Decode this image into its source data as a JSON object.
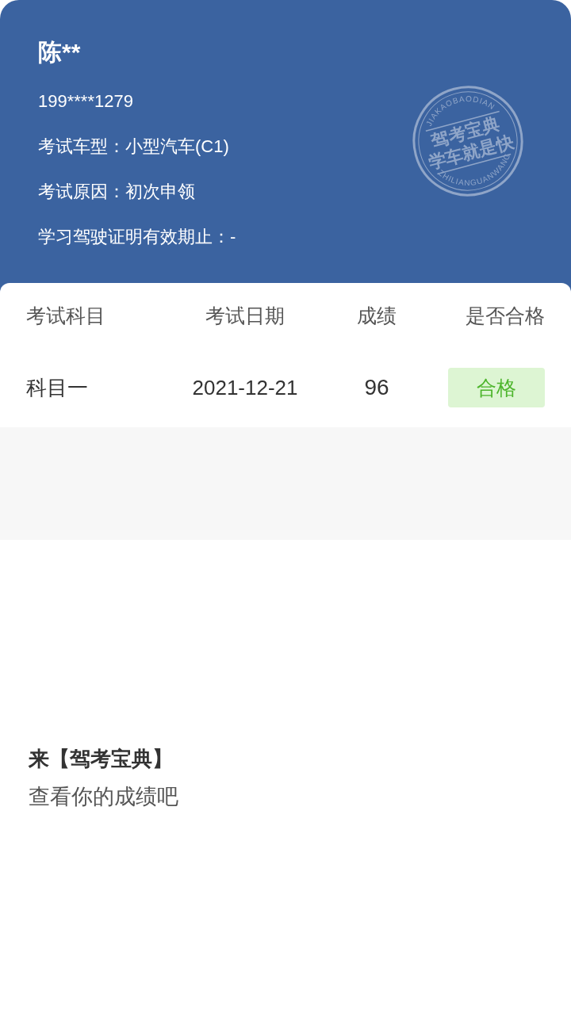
{
  "profile": {
    "name": "陈**",
    "phone": "199****1279",
    "details": [
      "考试车型：小型汽车(C1)",
      "考试原因：初次申领",
      "学习驾驶证明有效期止：-"
    ]
  },
  "seal": {
    "top_text": "JIAKAOBAODIAN",
    "lines": [
      "驾考宝典",
      "学车就是快"
    ],
    "bottom_text": "ZHILIANGUANWANG"
  },
  "table": {
    "columns": [
      "考试科目",
      "考试日期",
      "成绩",
      "是否合格"
    ],
    "rows": [
      {
        "subject": "科目一",
        "date": "2021-12-21",
        "score": "96",
        "result": "合格",
        "passed": true
      }
    ]
  },
  "promo": {
    "title": "来【驾考宝典】",
    "subtitle": "查看你的成绩吧"
  }
}
